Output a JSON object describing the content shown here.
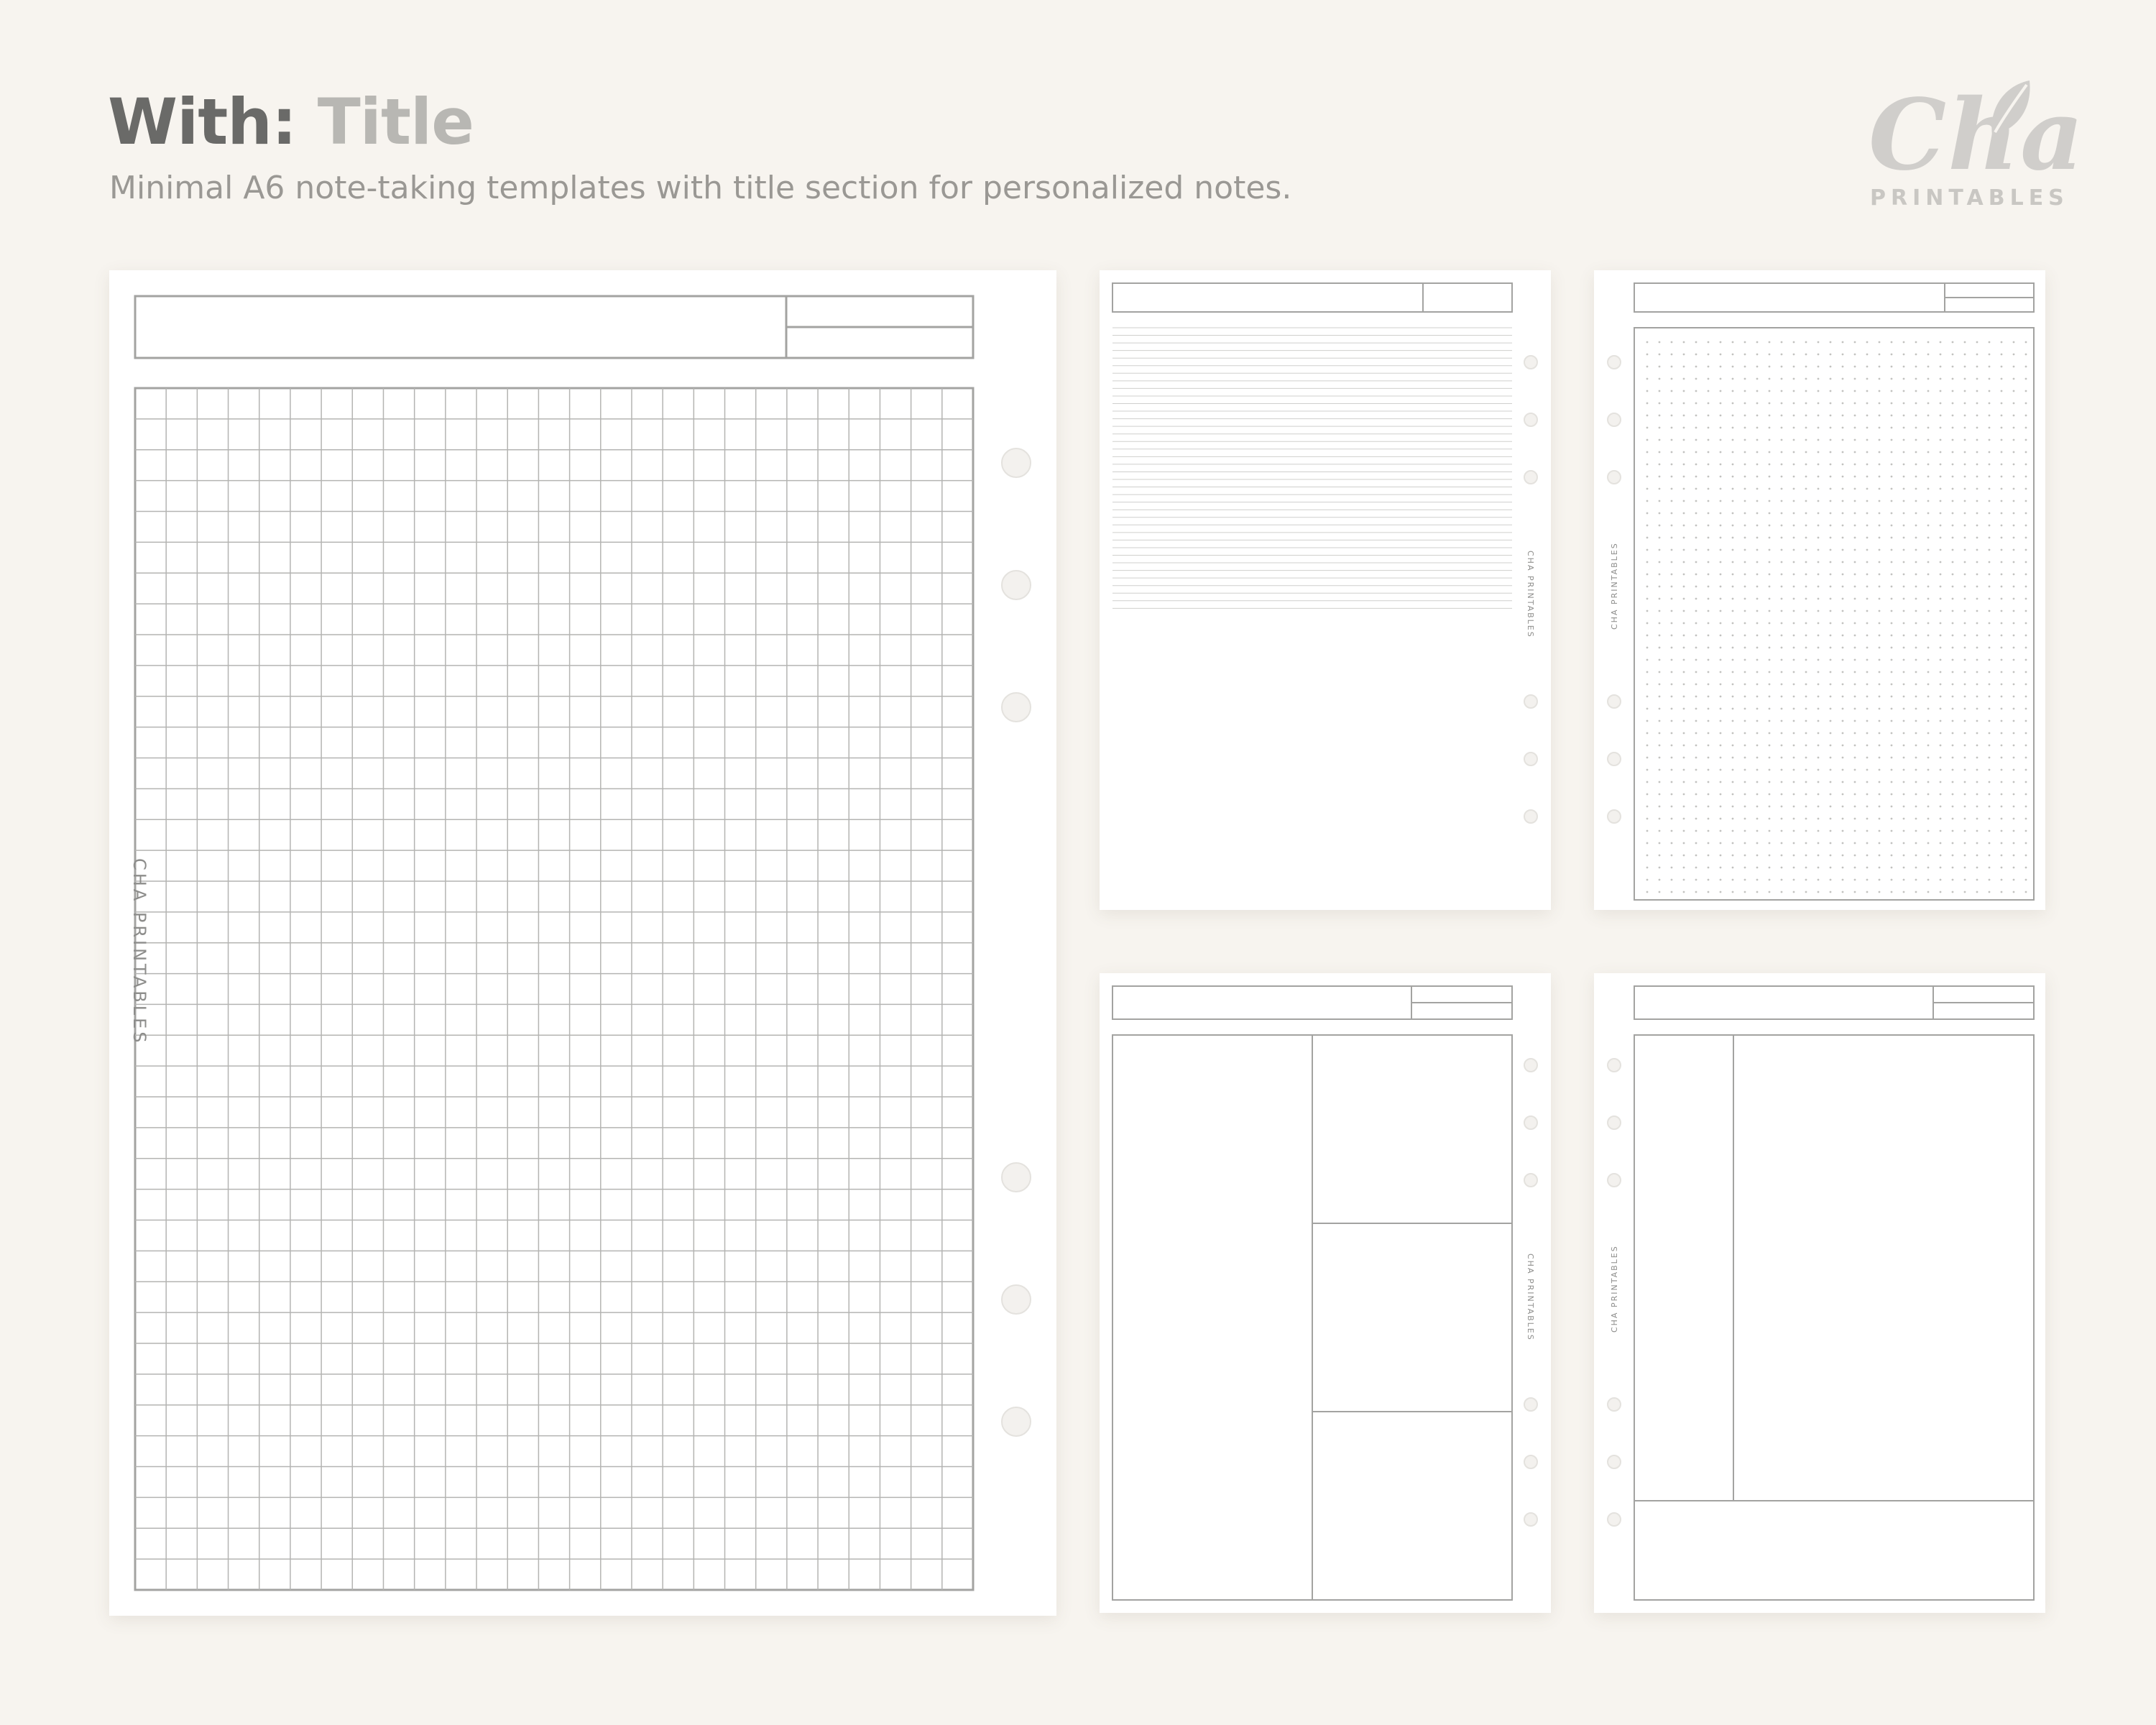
{
  "header": {
    "label": "With:",
    "title": "Title",
    "subtitle": "Minimal A6 note-taking templates with title section for personalized notes."
  },
  "logo": {
    "word": "Cha",
    "sub": "PRINTABLES"
  },
  "brand_text": "CHA PRINTABLES",
  "templates": [
    {
      "name": "grid",
      "ring_holes": 6
    },
    {
      "name": "lined",
      "ring_holes": 6
    },
    {
      "name": "dotted",
      "ring_holes": 6
    },
    {
      "name": "cornell-three-box",
      "ring_holes": 6
    },
    {
      "name": "cornell-classic",
      "ring_holes": 6
    }
  ],
  "colors": {
    "background": "#f7f4ef",
    "paper": "#ffffff",
    "line": "#a3a3a1",
    "light_line": "#cfcfcd"
  }
}
